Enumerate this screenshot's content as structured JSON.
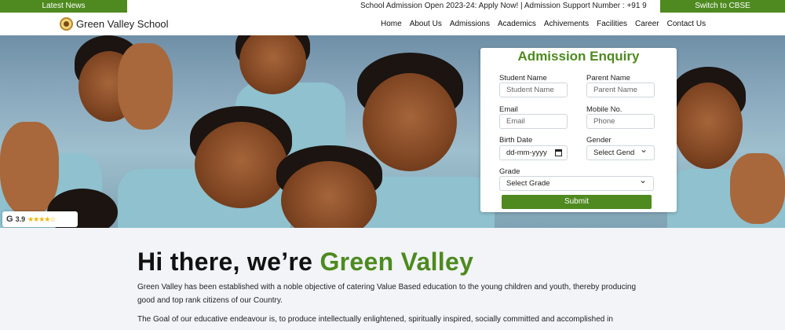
{
  "newsbar": {
    "label": "Latest News",
    "ticker": "School Admission Open 2023-24: Apply Now! | Admission Support Number : +91 9",
    "switch_label": "Switch to CBSE"
  },
  "header": {
    "brand": "Green Valley School",
    "nav": [
      "Home",
      "About Us",
      "Admissions",
      "Academics",
      "Achivements",
      "Facilities",
      "Career",
      "Contact Us"
    ]
  },
  "review": {
    "provider_letter": "G",
    "rating": "3.9",
    "stars": "★★★★☆",
    "stars_value": 3.9
  },
  "form": {
    "title": "Admission Enquiry",
    "student_name_label": "Student Name",
    "student_name_placeholder": "Student Name",
    "parent_name_label": "Parent Name",
    "parent_name_placeholder": "Parent Name",
    "email_label": "Email",
    "email_placeholder": "Email",
    "mobile_label": "Mobile No.",
    "mobile_placeholder": "Phone",
    "birth_date_label": "Birth Date",
    "birth_date_value": "dd-mm-yyyy",
    "gender_label": "Gender",
    "gender_value": "Select Gend",
    "grade_label": "Grade",
    "grade_value": "Select Grade",
    "submit_label": "Submit"
  },
  "intro": {
    "headline_prefix": "Hi there, we’re ",
    "headline_accent": "Green Valley",
    "paragraph1": "Green Valley has been established with a noble objective of catering Value Based education to the young children and youth, thereby producing good and top rank citizens of our Country.",
    "paragraph2": "The Goal of our educative endeavour is, to produce intellectually enlightened, spiritually inspired, socially committed and accomplished in"
  },
  "colors": {
    "brand_green": "#4e8a1f",
    "star_yellow": "#f3b400"
  }
}
